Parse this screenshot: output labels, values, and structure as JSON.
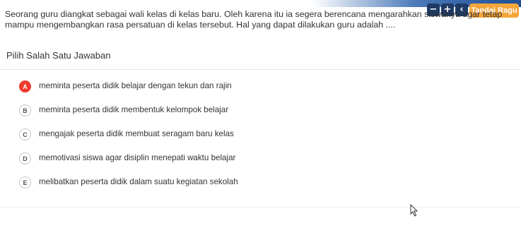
{
  "header": {
    "minus_label": "−",
    "plus_label": "+",
    "back_label": "‹",
    "ragu_label": "Tandai Ragu"
  },
  "question": {
    "text": "Seorang guru diangkat sebagai wali kelas di kelas baru. Oleh karena itu ia segera berencana mengarahkan siswanya agar tetap mampu mengembangkan rasa persatuan di kelas tersebut. Hal yang dapat dilakukan guru adalah ...."
  },
  "instruction": "Pilih Salah Satu Jawaban",
  "options": [
    {
      "letter": "A",
      "text": "meminta peserta didik belajar dengan tekun dan rajin",
      "selected": true
    },
    {
      "letter": "B",
      "text": "meminta peserta didik membentuk kelompok belajar",
      "selected": false
    },
    {
      "letter": "C",
      "text": "mengajak peserta didik membuat seragam baru kelas",
      "selected": false
    },
    {
      "letter": "D",
      "text": "memotivasi siswa agar disiplin menepati waktu belajar",
      "selected": false
    },
    {
      "letter": "E",
      "text": "melibatkan peserta didik dalam suatu kegiatan sekolah",
      "selected": false
    }
  ],
  "colors": {
    "selected": "#ef3b2d",
    "ragu": "#f4a63a",
    "control": "#1e3a64"
  }
}
